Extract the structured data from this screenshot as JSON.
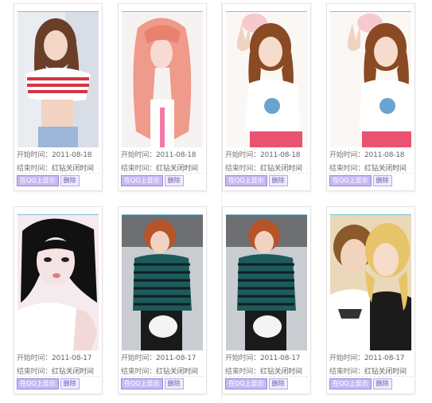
{
  "labels": {
    "start_prefix": "开始时间：",
    "end_prefix": "结束时间：",
    "end_value": "红钻关闭时间",
    "show_button": "在QQ上显示",
    "delete_button": "删除"
  },
  "items": [
    {
      "start": "2011-08-18",
      "image": "girl-striped-top-photo"
    },
    {
      "start": "2011-08-18",
      "image": "girl-pink-hair-photo"
    },
    {
      "start": "2011-08-18",
      "image": "girl-peace-sign-photo"
    },
    {
      "start": "2011-08-18",
      "image": "girl-peace-sign-photo"
    },
    {
      "start": "2011-08-17",
      "image": "girl-black-hair-closeup-photo"
    },
    {
      "start": "2011-08-17",
      "image": "boy-striped-sweater-photo"
    },
    {
      "start": "2011-08-17",
      "image": "boy-striped-sweater-photo"
    },
    {
      "start": "2011-08-17",
      "image": "couple-selfie-photo"
    }
  ]
}
